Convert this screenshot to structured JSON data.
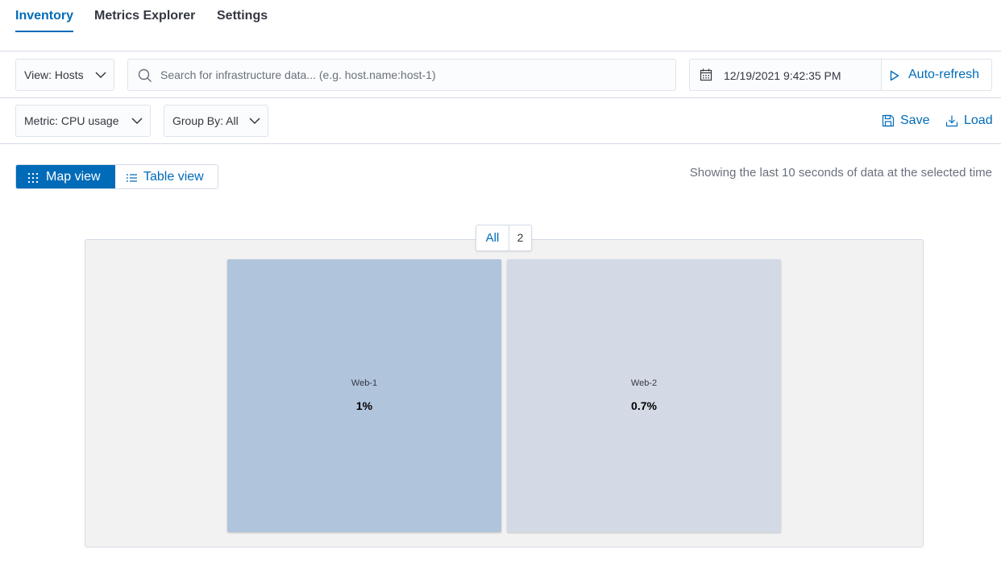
{
  "tabs": [
    {
      "label": "Inventory",
      "active": true
    },
    {
      "label": "Metrics Explorer",
      "active": false
    },
    {
      "label": "Settings",
      "active": false
    }
  ],
  "toolbar": {
    "view_select": "View: Hosts",
    "search_placeholder": "Search for infrastructure data... (e.g. host.name:host-1)",
    "date": "12/19/2021 9:42:35 PM",
    "auto_refresh": "Auto-refresh"
  },
  "filters": {
    "metric_select": "Metric: CPU usage",
    "group_by_select": "Group By: All",
    "save_label": "Save",
    "load_label": "Load"
  },
  "view_toggle": {
    "map_label": "Map view",
    "table_label": "Table view",
    "selected": "map"
  },
  "status_text": "Showing the last 10 seconds of data at the selected time",
  "map": {
    "group": {
      "name": "All",
      "count": "2"
    },
    "nodes": [
      {
        "name": "Web-1",
        "value": "1%",
        "color": "#b0c4dc"
      },
      {
        "name": "Web-2",
        "value": "0.7%",
        "color": "#d3dae6"
      }
    ]
  },
  "colors": {
    "accent": "#006bb8",
    "map_background": "#f2f2f2"
  }
}
